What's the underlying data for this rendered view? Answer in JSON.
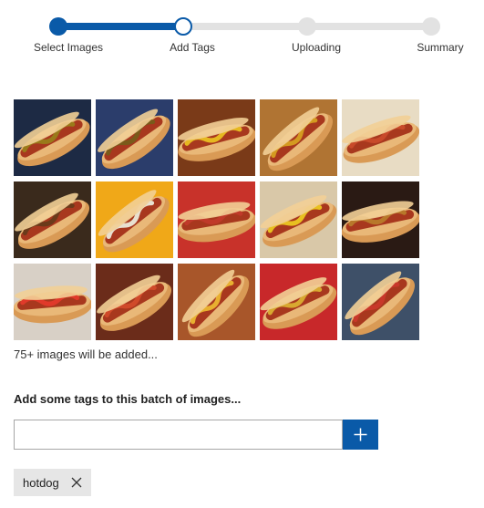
{
  "steps": [
    {
      "label": "Select Images",
      "state": "complete"
    },
    {
      "label": "Add Tags",
      "state": "current"
    },
    {
      "label": "Uploading",
      "state": "pending"
    },
    {
      "label": "Summary",
      "state": "pending"
    }
  ],
  "progress_fraction": 0.33,
  "images": {
    "count": 15,
    "count_text": "75+ images will be added..."
  },
  "tags_section": {
    "heading": "Add some tags to this batch of images...",
    "input_value": "",
    "input_placeholder": "",
    "add_icon": "plus-icon"
  },
  "tags": [
    {
      "label": "hotdog",
      "remove_icon": "close-icon"
    }
  ],
  "colors": {
    "accent": "#0a5aa8",
    "track_inactive": "#e2e2e2",
    "chip_bg": "#e6e6e6"
  }
}
